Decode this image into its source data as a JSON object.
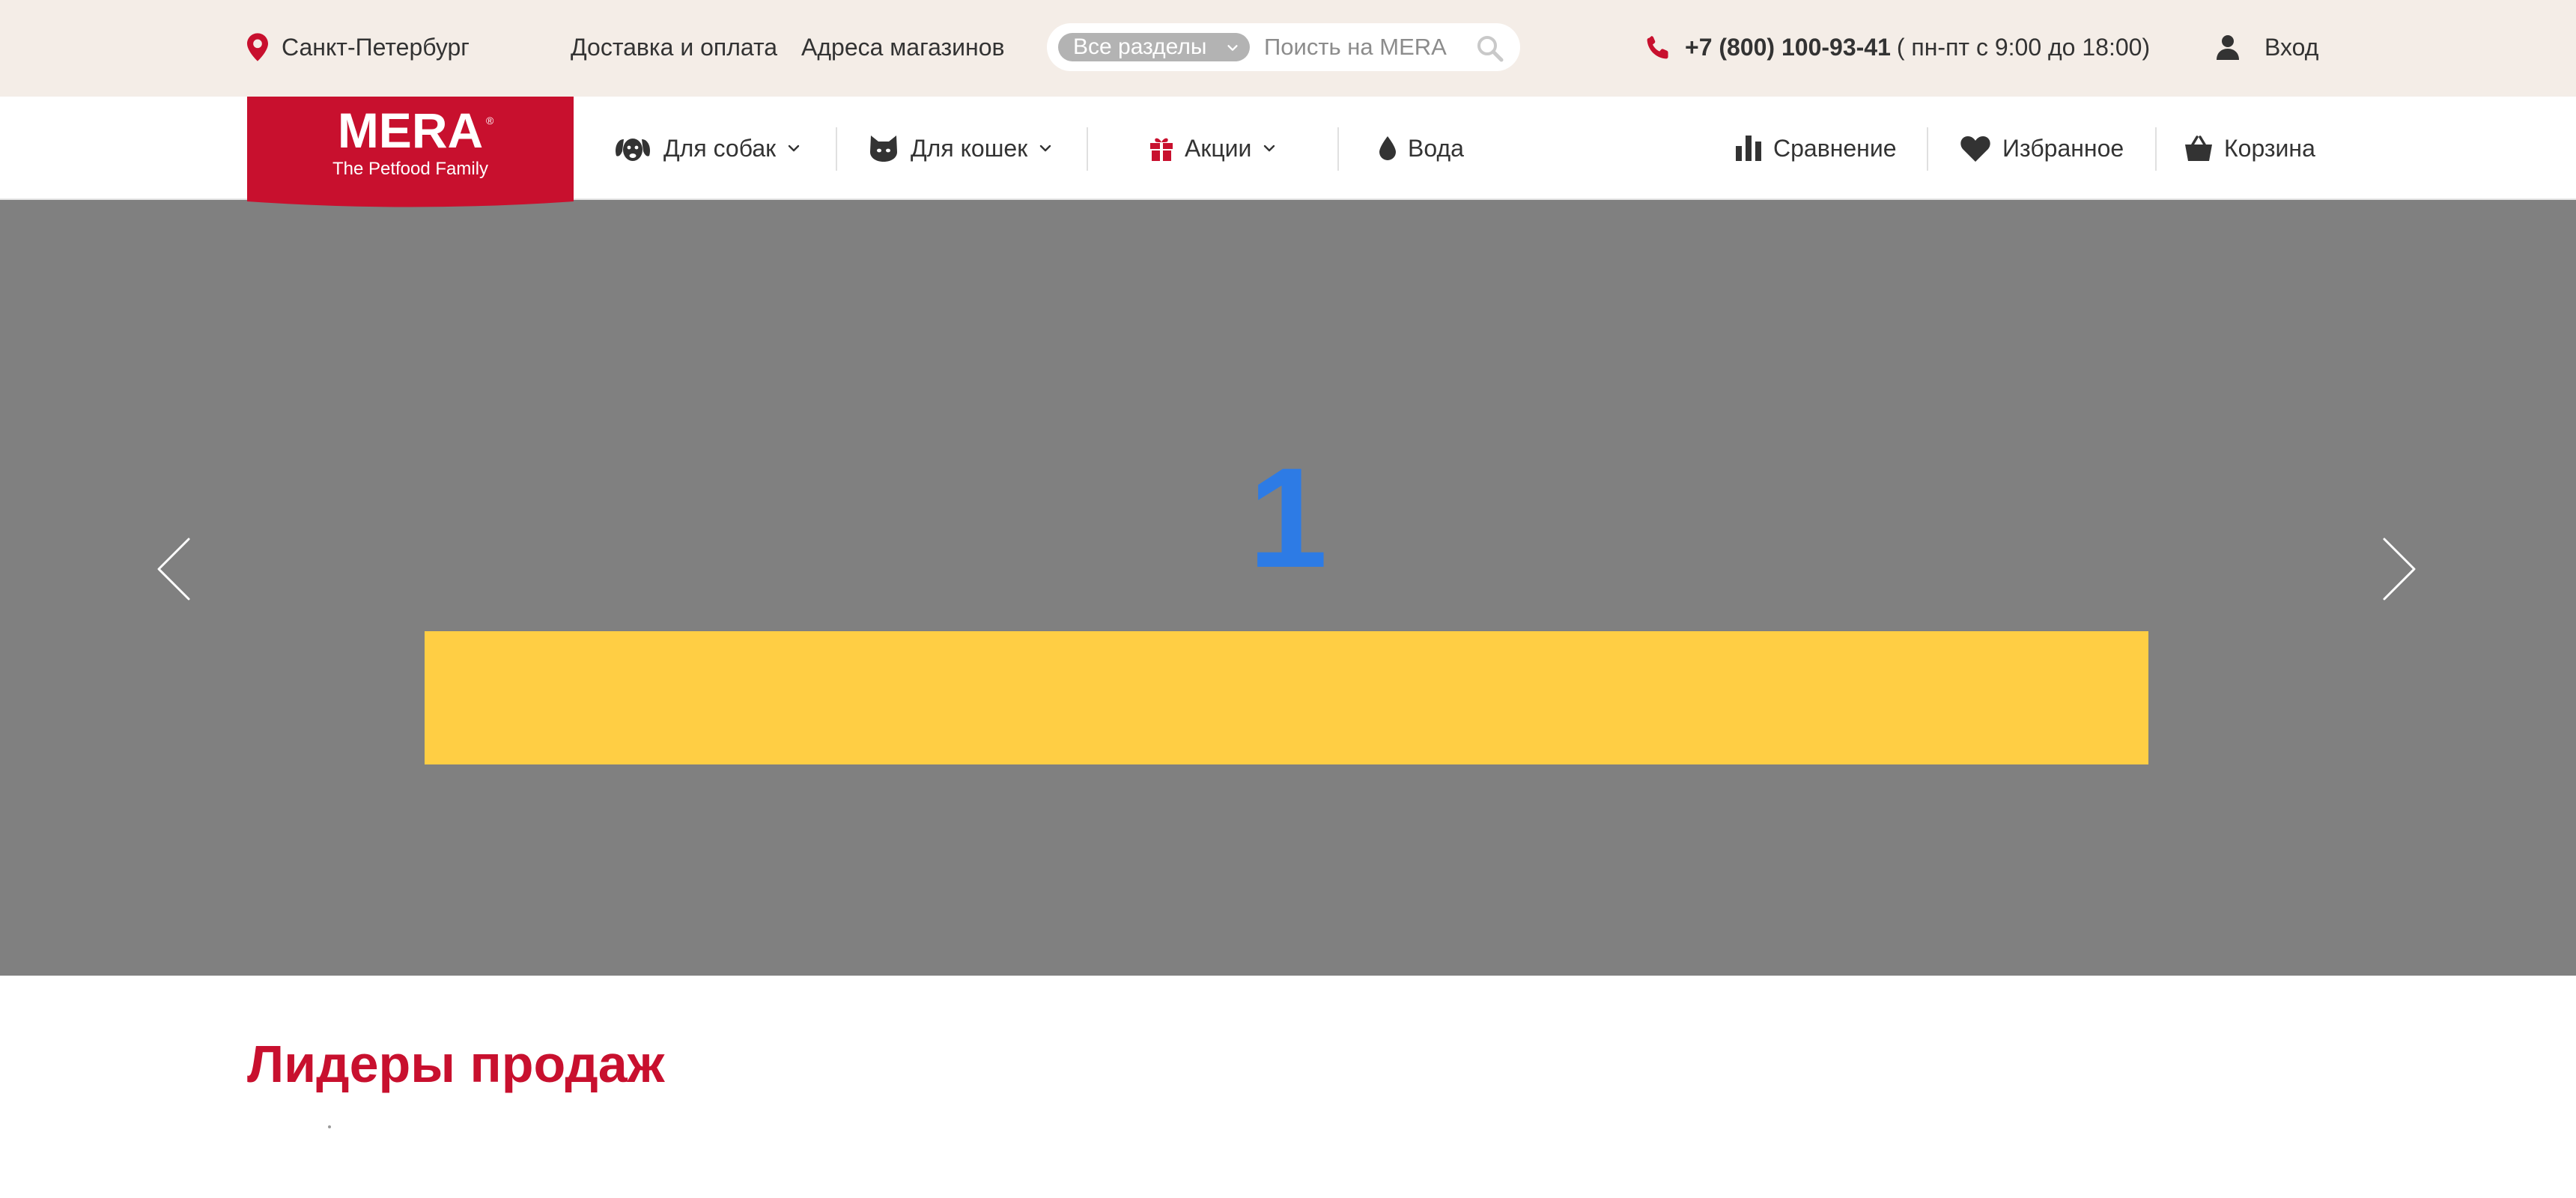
{
  "topbar": {
    "city": "Санкт-Петербург",
    "links": [
      "Доставка и оплата",
      "Адреса магазинов"
    ],
    "search": {
      "section_label": "Все разделы",
      "placeholder": "Поисть на MERA"
    },
    "phone": "+7 (800) 100-93-41",
    "hours": "( пн-пт с 9:00 до 18:00)",
    "login": "Вход"
  },
  "logo": {
    "brand": "MERA",
    "tagline": "The Petfood Family"
  },
  "nav": {
    "items": [
      {
        "label": "Для собак",
        "icon": "dog-icon",
        "dropdown": true
      },
      {
        "label": "Для кошек",
        "icon": "cat-icon",
        "dropdown": true
      },
      {
        "label": "Акции",
        "icon": "gift-icon",
        "dropdown": true
      },
      {
        "label": "Вода",
        "icon": "water-drop-icon",
        "dropdown": false
      }
    ],
    "actions": [
      {
        "label": "Сравнение",
        "icon": "compare-icon"
      },
      {
        "label": "Избранное",
        "icon": "heart-icon"
      },
      {
        "label": "Корзина",
        "icon": "basket-icon"
      }
    ]
  },
  "hero": {
    "slide_number": "1",
    "prev_icon": "chevron-left-icon",
    "next_icon": "chevron-right-icon"
  },
  "section": {
    "title": "Лидеры продаж"
  },
  "colors": {
    "brand_red": "#c8102e",
    "topbar_bg": "#f4ede7",
    "hero_bg": "#808080",
    "banner_yellow": "#ffce44",
    "slide_number_blue": "#2d7be5"
  }
}
